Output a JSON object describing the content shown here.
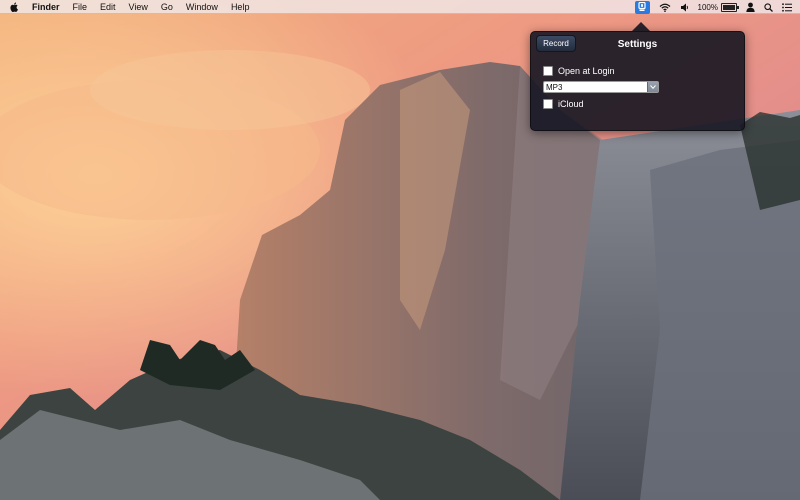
{
  "menubar": {
    "app_name": "Finder",
    "menus": [
      "File",
      "Edit",
      "View",
      "Go",
      "Window",
      "Help"
    ],
    "status": {
      "battery_percent": "100%",
      "battery_level": 1.0,
      "icons": [
        "app-status-icon",
        "wifi-icon",
        "volume-icon",
        "battery-icon",
        "user-icon",
        "search-icon",
        "list-icon"
      ]
    }
  },
  "popover": {
    "title": "Settings",
    "record_label": "Record",
    "open_at_login_label": "Open at Login",
    "open_at_login_checked": false,
    "format_value": "MP3",
    "icloud_label": "iCloud",
    "icloud_checked": false
  },
  "colors": {
    "status_highlight": "#2a7be0",
    "popover_bg": "#161622"
  }
}
